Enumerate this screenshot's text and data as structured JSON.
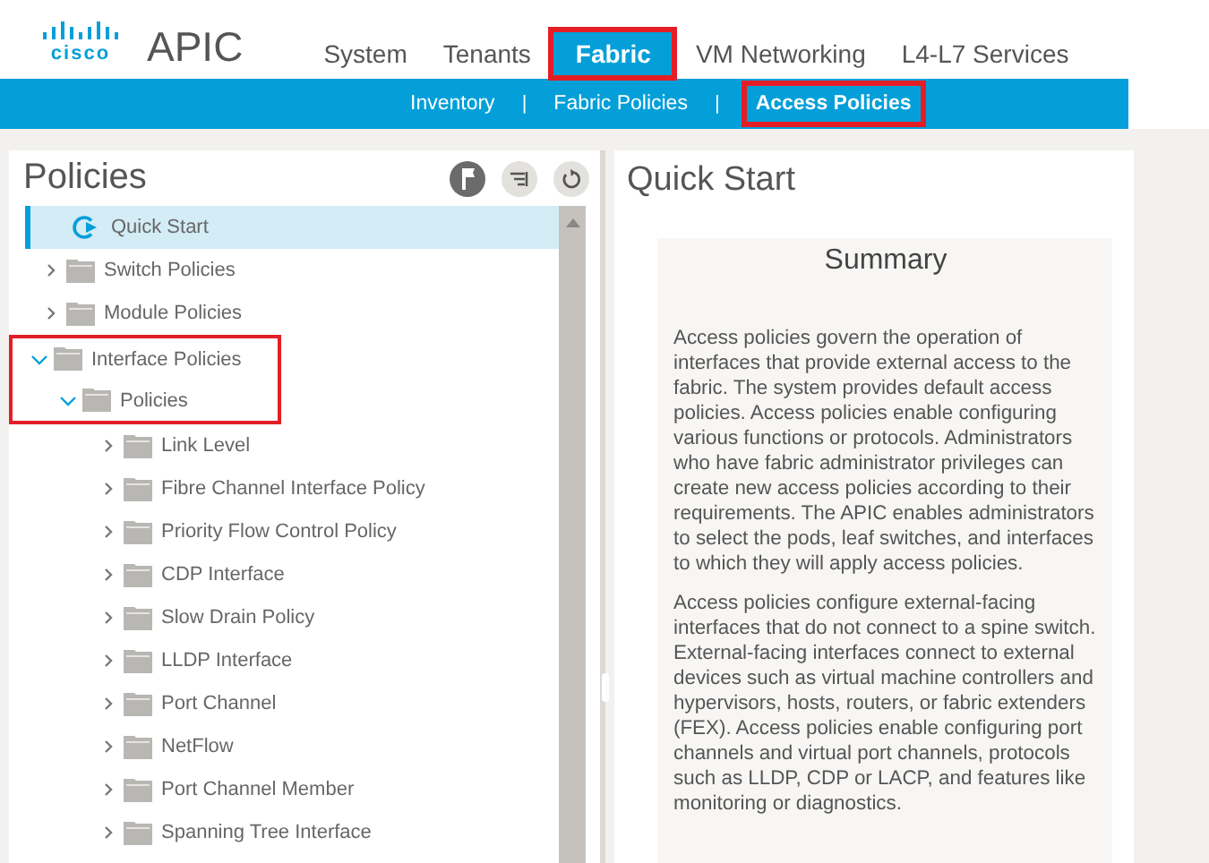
{
  "header": {
    "logo_text": "cisco",
    "app_name": "APIC"
  },
  "nav_tabs": [
    {
      "label": "System",
      "selected": false,
      "highlighted": false
    },
    {
      "label": "Tenants",
      "selected": false,
      "highlighted": false
    },
    {
      "label": "Fabric",
      "selected": true,
      "highlighted": true
    },
    {
      "label": "VM Networking",
      "selected": false,
      "highlighted": false
    },
    {
      "label": "L4-L7 Services",
      "selected": false,
      "highlighted": false
    }
  ],
  "sub_tabs": [
    {
      "label": "Inventory",
      "selected": false,
      "highlighted": false
    },
    {
      "label": "Fabric Policies",
      "selected": false,
      "highlighted": false
    },
    {
      "label": "Access Policies",
      "selected": true,
      "highlighted": true
    }
  ],
  "sub_separator": "|",
  "sidebar": {
    "title": "Policies",
    "items": [
      {
        "label": "Quick Start",
        "kind": "quickstart",
        "selected": true,
        "highlighted": false
      },
      {
        "label": "Switch Policies",
        "kind": "folder",
        "selected": false,
        "expanded": false,
        "highlighted": false
      },
      {
        "label": "Module Policies",
        "kind": "folder",
        "selected": false,
        "expanded": false,
        "highlighted": false
      },
      {
        "label": "Interface Policies",
        "kind": "folder",
        "selected": false,
        "expanded": true,
        "highlighted": true,
        "children": [
          {
            "label": "Policies",
            "kind": "folder",
            "selected": false,
            "expanded": true,
            "highlighted": true,
            "children": [
              {
                "label": "Link Level",
                "kind": "folder",
                "selected": false,
                "expanded": false,
                "highlighted": false
              },
              {
                "label": "Fibre Channel Interface Policy",
                "kind": "folder",
                "selected": false,
                "expanded": false,
                "highlighted": false
              },
              {
                "label": "Priority Flow Control Policy",
                "kind": "folder",
                "selected": false,
                "expanded": false,
                "highlighted": false
              },
              {
                "label": "CDP Interface",
                "kind": "folder",
                "selected": false,
                "expanded": false,
                "highlighted": false
              },
              {
                "label": "Slow Drain Policy",
                "kind": "folder",
                "selected": false,
                "expanded": false,
                "highlighted": false
              },
              {
                "label": "LLDP Interface",
                "kind": "folder",
                "selected": false,
                "expanded": false,
                "highlighted": false
              },
              {
                "label": "Port Channel",
                "kind": "folder",
                "selected": false,
                "expanded": false,
                "highlighted": false
              },
              {
                "label": "NetFlow",
                "kind": "folder",
                "selected": false,
                "expanded": false,
                "highlighted": false
              },
              {
                "label": "Port Channel Member",
                "kind": "folder",
                "selected": false,
                "expanded": false,
                "highlighted": false
              },
              {
                "label": "Spanning Tree Interface",
                "kind": "folder",
                "selected": false,
                "expanded": false,
                "highlighted": false
              }
            ]
          }
        ]
      }
    ]
  },
  "content": {
    "title": "Quick Start",
    "summary_title": "Summary",
    "paragraphs": [
      "Access policies govern the operation of interfaces that provide external access to the fabric. The system provides default access policies. Access policies enable configuring various functions or protocols. Administrators who have fabric administrator privileges can create new access policies according to their requirements. The APIC enables administrators to select the pods, leaf switches, and interfaces to which they will apply access policies.",
      "Access policies configure external-facing interfaces that do not connect to a spine switch. External-facing interfaces connect to external devices such as virtual machine controllers and hypervisors, hosts, routers, or fabric extenders (FEX). Access policies enable configuring port channels and virtual port channels, protocols such as LLDP, CDP or LACP, and features like monitoring or diagnostics."
    ]
  }
}
